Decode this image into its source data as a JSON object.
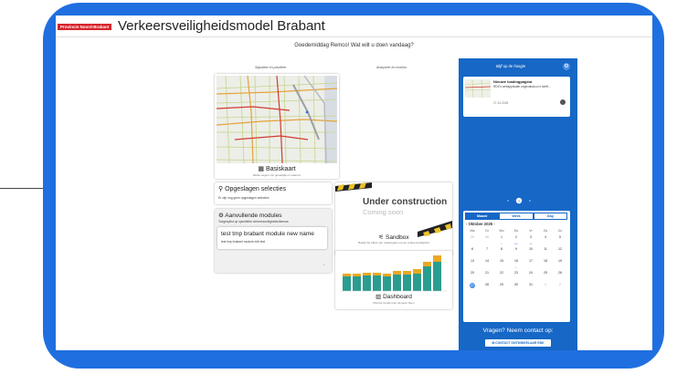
{
  "brand": {
    "badge": "Provincie Noord-Brabant",
    "title": "Verkeersveiligheidsmodel Brabant"
  },
  "greeting": "Goedemiddag Remco! Wat wilt u doen vandaag?",
  "columns": {
    "left": "Signaleer en prioriteer",
    "middle": "Analyseer en monitor",
    "right": "Blijf op de hoogte"
  },
  "basiskaart": {
    "icon": "map-icon",
    "title": "Basiskaart",
    "subtitle": "Welke wegen zijn gevaarlijk en waarom"
  },
  "opgeslagen": {
    "icon": "search-icon",
    "title": "Opgeslagen selecties",
    "text": "Er zijn nog geen opgeslagen selecties"
  },
  "modules": {
    "icon": "puzzle-icon",
    "title": "Aanvullende modules",
    "subtitle": "Toegespitst op specifieke verkeersveiligheidsthemas",
    "item_title": "test tmp brabant module new name",
    "item_desc": "test tmp brabant module edit test",
    "chevron": "chevron-down-icon"
  },
  "sandbox": {
    "banner_title": "Under construction",
    "banner_sub": "Coming soon",
    "icon": "sliders-icon",
    "title": "Sandbox",
    "subtitle": "Bekijk het effect van maatregelen op de verkeersveiligheid"
  },
  "dashboard": {
    "icon": "bar-chart-icon",
    "title": "Dashboard",
    "subtitle": "Monitor trends over de jaren heen"
  },
  "news": {
    "title": "Nieuwe loadingpagina",
    "text": "RDK's webapplicatie ongevalsloco nl heeft...",
    "date": "27-10-2025"
  },
  "calendar": {
    "tabs": [
      "Maand",
      "Week",
      "Dag"
    ],
    "month": "Oktober 2025",
    "days": [
      "Ma",
      "Di",
      "Wo",
      "Do",
      "Vr",
      "Za",
      "Zo"
    ],
    "weeks": [
      [
        "29",
        "30",
        "1",
        "2",
        "3",
        "4",
        "5"
      ],
      [
        "6",
        "7",
        "8",
        "9",
        "10",
        "11",
        "12"
      ],
      [
        "13",
        "14",
        "15",
        "16",
        "17",
        "18",
        "19"
      ],
      [
        "20",
        "21",
        "22",
        "23",
        "24",
        "25",
        "26"
      ],
      [
        "27",
        "28",
        "29",
        "30",
        "31",
        "1",
        "2"
      ]
    ]
  },
  "contact": {
    "title": "Vragen? Neem contact op:",
    "button": "CONTACT ONTWIKKELAAR RDK"
  },
  "colors": {
    "primary": "#1667c6",
    "frame": "#1f6fe0",
    "brand_red": "#d8232a",
    "teal": "#2a9d8f",
    "amber": "#e9a825"
  }
}
